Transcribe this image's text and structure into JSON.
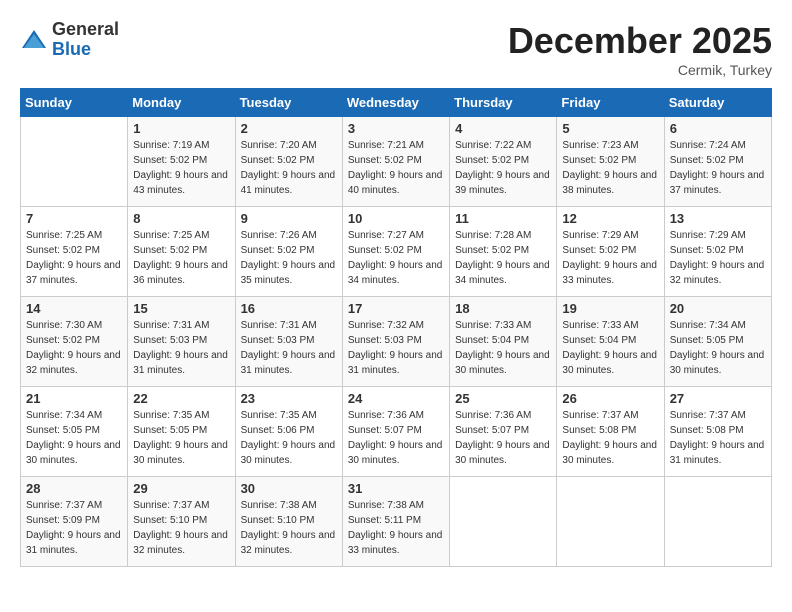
{
  "logo": {
    "general": "General",
    "blue": "Blue"
  },
  "title": "December 2025",
  "location": "Cermik, Turkey",
  "days_of_week": [
    "Sunday",
    "Monday",
    "Tuesday",
    "Wednesday",
    "Thursday",
    "Friday",
    "Saturday"
  ],
  "weeks": [
    [
      {
        "day": "",
        "sunrise": "",
        "sunset": "",
        "daylight": ""
      },
      {
        "day": "1",
        "sunrise": "Sunrise: 7:19 AM",
        "sunset": "Sunset: 5:02 PM",
        "daylight": "Daylight: 9 hours and 43 minutes."
      },
      {
        "day": "2",
        "sunrise": "Sunrise: 7:20 AM",
        "sunset": "Sunset: 5:02 PM",
        "daylight": "Daylight: 9 hours and 41 minutes."
      },
      {
        "day": "3",
        "sunrise": "Sunrise: 7:21 AM",
        "sunset": "Sunset: 5:02 PM",
        "daylight": "Daylight: 9 hours and 40 minutes."
      },
      {
        "day": "4",
        "sunrise": "Sunrise: 7:22 AM",
        "sunset": "Sunset: 5:02 PM",
        "daylight": "Daylight: 9 hours and 39 minutes."
      },
      {
        "day": "5",
        "sunrise": "Sunrise: 7:23 AM",
        "sunset": "Sunset: 5:02 PM",
        "daylight": "Daylight: 9 hours and 38 minutes."
      },
      {
        "day": "6",
        "sunrise": "Sunrise: 7:24 AM",
        "sunset": "Sunset: 5:02 PM",
        "daylight": "Daylight: 9 hours and 37 minutes."
      }
    ],
    [
      {
        "day": "7",
        "sunrise": "Sunrise: 7:25 AM",
        "sunset": "Sunset: 5:02 PM",
        "daylight": "Daylight: 9 hours and 37 minutes."
      },
      {
        "day": "8",
        "sunrise": "Sunrise: 7:25 AM",
        "sunset": "Sunset: 5:02 PM",
        "daylight": "Daylight: 9 hours and 36 minutes."
      },
      {
        "day": "9",
        "sunrise": "Sunrise: 7:26 AM",
        "sunset": "Sunset: 5:02 PM",
        "daylight": "Daylight: 9 hours and 35 minutes."
      },
      {
        "day": "10",
        "sunrise": "Sunrise: 7:27 AM",
        "sunset": "Sunset: 5:02 PM",
        "daylight": "Daylight: 9 hours and 34 minutes."
      },
      {
        "day": "11",
        "sunrise": "Sunrise: 7:28 AM",
        "sunset": "Sunset: 5:02 PM",
        "daylight": "Daylight: 9 hours and 34 minutes."
      },
      {
        "day": "12",
        "sunrise": "Sunrise: 7:29 AM",
        "sunset": "Sunset: 5:02 PM",
        "daylight": "Daylight: 9 hours and 33 minutes."
      },
      {
        "day": "13",
        "sunrise": "Sunrise: 7:29 AM",
        "sunset": "Sunset: 5:02 PM",
        "daylight": "Daylight: 9 hours and 32 minutes."
      }
    ],
    [
      {
        "day": "14",
        "sunrise": "Sunrise: 7:30 AM",
        "sunset": "Sunset: 5:02 PM",
        "daylight": "Daylight: 9 hours and 32 minutes."
      },
      {
        "day": "15",
        "sunrise": "Sunrise: 7:31 AM",
        "sunset": "Sunset: 5:03 PM",
        "daylight": "Daylight: 9 hours and 31 minutes."
      },
      {
        "day": "16",
        "sunrise": "Sunrise: 7:31 AM",
        "sunset": "Sunset: 5:03 PM",
        "daylight": "Daylight: 9 hours and 31 minutes."
      },
      {
        "day": "17",
        "sunrise": "Sunrise: 7:32 AM",
        "sunset": "Sunset: 5:03 PM",
        "daylight": "Daylight: 9 hours and 31 minutes."
      },
      {
        "day": "18",
        "sunrise": "Sunrise: 7:33 AM",
        "sunset": "Sunset: 5:04 PM",
        "daylight": "Daylight: 9 hours and 30 minutes."
      },
      {
        "day": "19",
        "sunrise": "Sunrise: 7:33 AM",
        "sunset": "Sunset: 5:04 PM",
        "daylight": "Daylight: 9 hours and 30 minutes."
      },
      {
        "day": "20",
        "sunrise": "Sunrise: 7:34 AM",
        "sunset": "Sunset: 5:05 PM",
        "daylight": "Daylight: 9 hours and 30 minutes."
      }
    ],
    [
      {
        "day": "21",
        "sunrise": "Sunrise: 7:34 AM",
        "sunset": "Sunset: 5:05 PM",
        "daylight": "Daylight: 9 hours and 30 minutes."
      },
      {
        "day": "22",
        "sunrise": "Sunrise: 7:35 AM",
        "sunset": "Sunset: 5:05 PM",
        "daylight": "Daylight: 9 hours and 30 minutes."
      },
      {
        "day": "23",
        "sunrise": "Sunrise: 7:35 AM",
        "sunset": "Sunset: 5:06 PM",
        "daylight": "Daylight: 9 hours and 30 minutes."
      },
      {
        "day": "24",
        "sunrise": "Sunrise: 7:36 AM",
        "sunset": "Sunset: 5:07 PM",
        "daylight": "Daylight: 9 hours and 30 minutes."
      },
      {
        "day": "25",
        "sunrise": "Sunrise: 7:36 AM",
        "sunset": "Sunset: 5:07 PM",
        "daylight": "Daylight: 9 hours and 30 minutes."
      },
      {
        "day": "26",
        "sunrise": "Sunrise: 7:37 AM",
        "sunset": "Sunset: 5:08 PM",
        "daylight": "Daylight: 9 hours and 30 minutes."
      },
      {
        "day": "27",
        "sunrise": "Sunrise: 7:37 AM",
        "sunset": "Sunset: 5:08 PM",
        "daylight": "Daylight: 9 hours and 31 minutes."
      }
    ],
    [
      {
        "day": "28",
        "sunrise": "Sunrise: 7:37 AM",
        "sunset": "Sunset: 5:09 PM",
        "daylight": "Daylight: 9 hours and 31 minutes."
      },
      {
        "day": "29",
        "sunrise": "Sunrise: 7:37 AM",
        "sunset": "Sunset: 5:10 PM",
        "daylight": "Daylight: 9 hours and 32 minutes."
      },
      {
        "day": "30",
        "sunrise": "Sunrise: 7:38 AM",
        "sunset": "Sunset: 5:10 PM",
        "daylight": "Daylight: 9 hours and 32 minutes."
      },
      {
        "day": "31",
        "sunrise": "Sunrise: 7:38 AM",
        "sunset": "Sunset: 5:11 PM",
        "daylight": "Daylight: 9 hours and 33 minutes."
      },
      {
        "day": "",
        "sunrise": "",
        "sunset": "",
        "daylight": ""
      },
      {
        "day": "",
        "sunrise": "",
        "sunset": "",
        "daylight": ""
      },
      {
        "day": "",
        "sunrise": "",
        "sunset": "",
        "daylight": ""
      }
    ]
  ]
}
